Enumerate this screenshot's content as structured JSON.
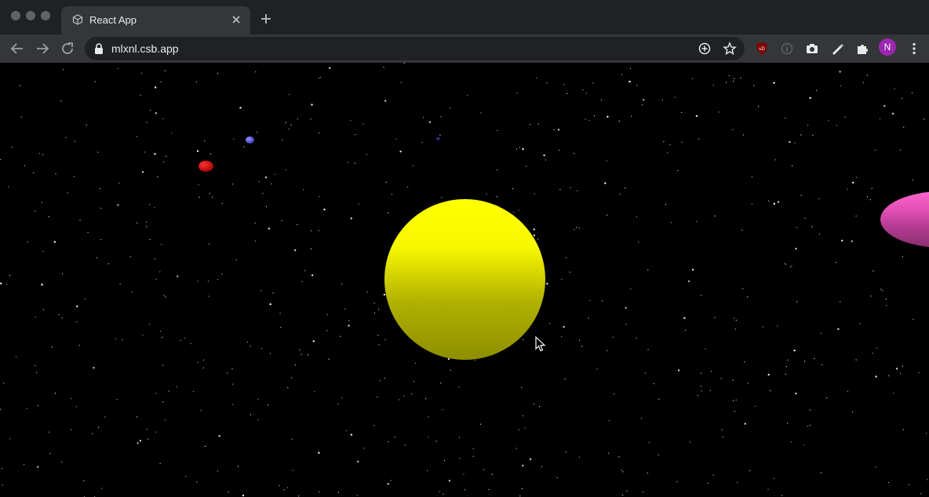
{
  "browser": {
    "tab": {
      "title": "React App"
    },
    "address": {
      "url": "mlxnl.csb.app"
    },
    "avatar_initial": "N",
    "extensions": [
      "ublock-icon",
      "info-icon",
      "camera-icon",
      "pen-icon",
      "puzzle-icon"
    ]
  },
  "scene": {
    "background_color": "#000000",
    "sun_color": "#ffff00",
    "planets": [
      {
        "name": "red-planet",
        "color": "#e02020"
      },
      {
        "name": "blue-planet",
        "color": "#6a6ae0"
      },
      {
        "name": "pink-planet",
        "color": "#ff66cc"
      }
    ]
  }
}
